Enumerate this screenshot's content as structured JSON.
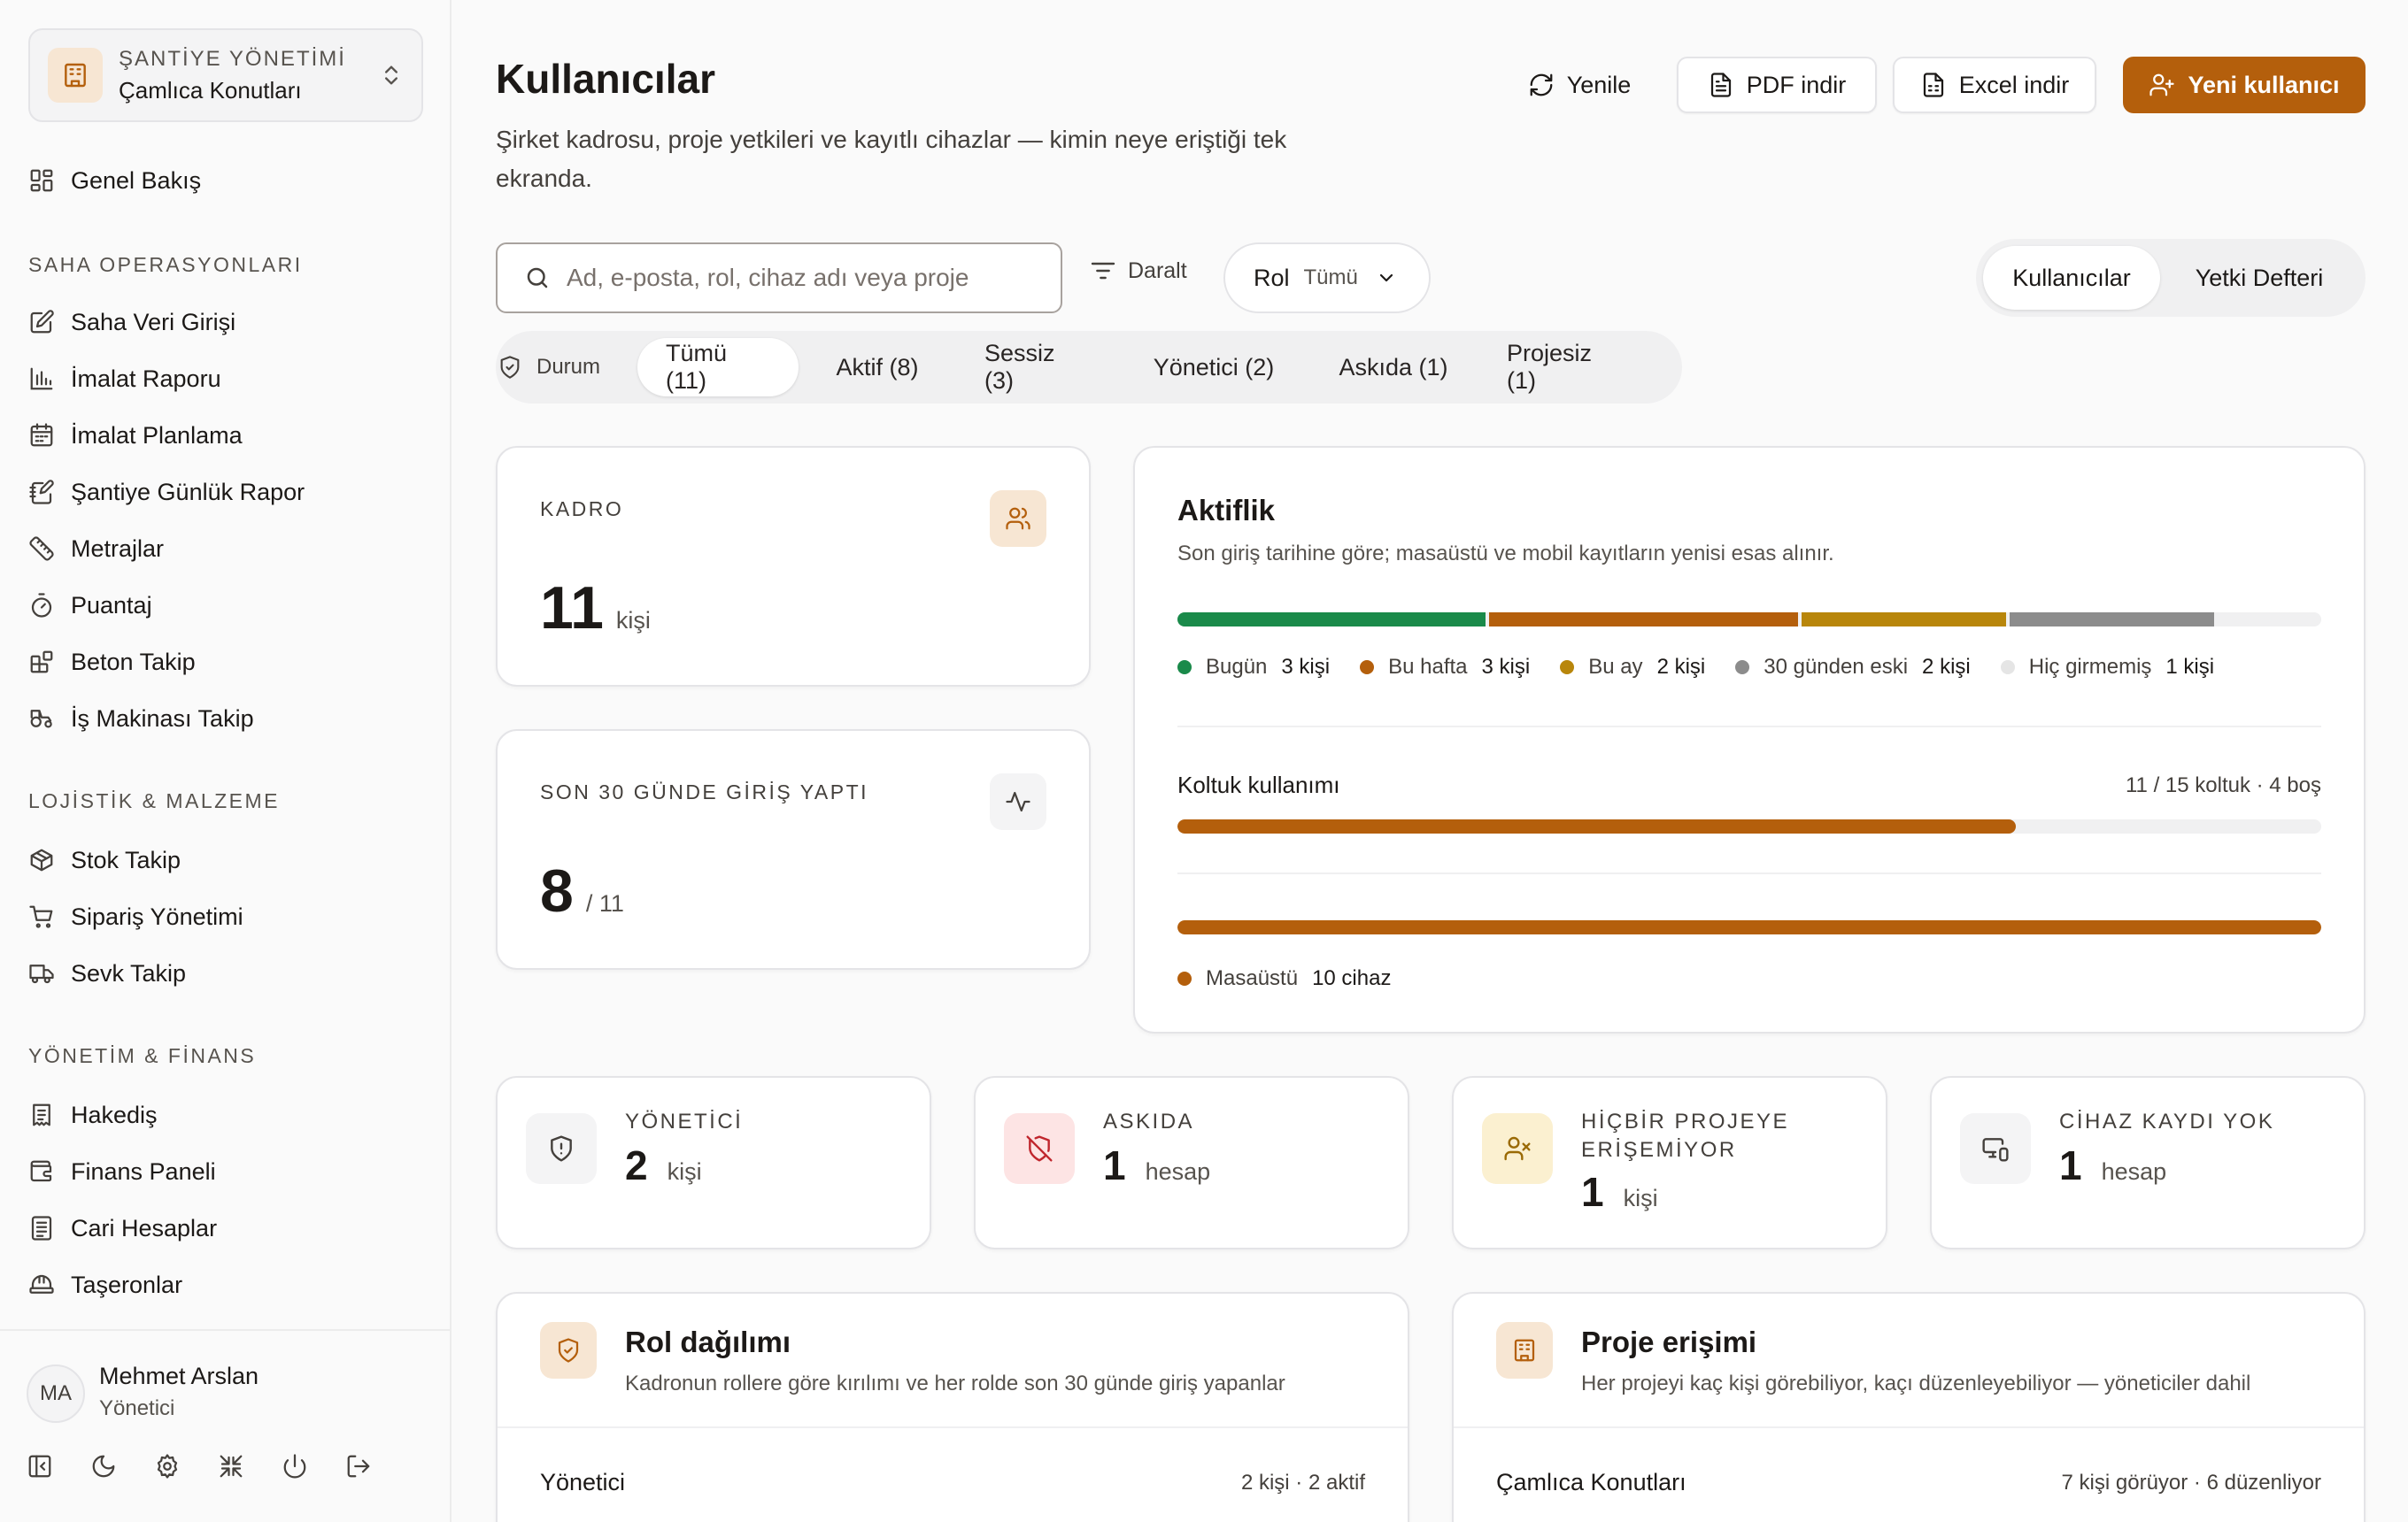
{
  "colors": {
    "accent": "#b45f0c",
    "today": "#1a8a4a",
    "this_week": "#b45f0c",
    "this_month": "#b8860b",
    "older": "#8c8c8c",
    "never": "#e5e5e5"
  },
  "sidebar": {
    "project_switcher": {
      "label": "ŞANTİYE YÖNETİMİ",
      "name": "Çamlıca Konutları",
      "icon": "building-icon"
    },
    "overview": {
      "label": "Genel Bakış",
      "icon": "layout-grid-icon"
    },
    "sections": [
      {
        "title": "SAHA OPERASYONLARI",
        "items": [
          {
            "label": "Saha Veri Girişi",
            "icon": "edit-icon"
          },
          {
            "label": "İmalat Raporu",
            "icon": "bar-chart-icon"
          },
          {
            "label": "İmalat Planlama",
            "icon": "calendar-icon"
          },
          {
            "label": "Şantiye Günlük Rapor",
            "icon": "notebook-pen-icon"
          },
          {
            "label": "Metrajlar",
            "icon": "ruler-icon"
          },
          {
            "label": "Puantaj",
            "icon": "timer-icon"
          },
          {
            "label": "Beton Takip",
            "icon": "blocks-icon"
          },
          {
            "label": "İş Makinası Takip",
            "icon": "tractor-icon"
          }
        ]
      },
      {
        "title": "LOJİSTİK & MALZEME",
        "items": [
          {
            "label": "Stok Takip",
            "icon": "package-icon"
          },
          {
            "label": "Sipariş Yönetimi",
            "icon": "cart-icon"
          },
          {
            "label": "Sevk Takip",
            "icon": "truck-icon"
          }
        ]
      },
      {
        "title": "YÖNETİM & FİNANS",
        "items": [
          {
            "label": "Hakediş",
            "icon": "receipt-icon"
          },
          {
            "label": "Finans Paneli",
            "icon": "wallet-icon"
          },
          {
            "label": "Cari Hesaplar",
            "icon": "ledger-icon"
          },
          {
            "label": "Taşeronlar",
            "icon": "hard-hat-icon"
          }
        ]
      }
    ],
    "user": {
      "initials": "MA",
      "name": "Mehmet Arslan",
      "role": "Yönetici"
    }
  },
  "header": {
    "title": "Kullanıcılar",
    "description": "Şirket kadrosu, proje yetkileri ve kayıtlı cihazlar — kimin neye eriştiği tek ekranda.",
    "refresh_label": "Yenile",
    "pdf_label": "PDF indir",
    "excel_label": "Excel indir",
    "new_user_label": "Yeni kullanıcı"
  },
  "filters": {
    "search_placeholder": "Ad, e-posta, rol, cihaz adı veya proje",
    "narrow_label": "Daralt",
    "role_label": "Rol",
    "role_value": "Tümü",
    "status_label": "Durum",
    "status_chips": [
      "Tümü (11)",
      "Aktif (8)",
      "Sessiz (3)",
      "Yönetici (2)",
      "Askıda (1)",
      "Projesiz (1)"
    ],
    "view_tabs": [
      "Kullanıcılar",
      "Yetki Defteri"
    ]
  },
  "stats": {
    "staff": {
      "label": "KADRO",
      "value": "11",
      "unit": "kişi"
    },
    "logged_in": {
      "label": "SON 30 GÜNDE GİRİŞ YAPTI",
      "value": "8",
      "unit": "/ 11"
    }
  },
  "activity": {
    "title": "Aktiflik",
    "subtitle": "Son giriş tarihine göre; masaüstü ve mobil kayıtların yenisi esas alınır.",
    "segments": [
      {
        "label": "Bugün",
        "count": "3 kişi",
        "value": 3,
        "color": "#1a8a4a"
      },
      {
        "label": "Bu hafta",
        "count": "3 kişi",
        "value": 3,
        "color": "#b45f0c"
      },
      {
        "label": "Bu ay",
        "count": "2 kişi",
        "value": 2,
        "color": "#b8860b"
      },
      {
        "label": "30 günden eski",
        "count": "2 kişi",
        "value": 2,
        "color": "#8c8c8c"
      },
      {
        "label": "Hiç girmemiş",
        "count": "1 kişi",
        "value": 1,
        "color": "#e5e5e5"
      }
    ],
    "seat_label": "Koltuk kullanımı",
    "seat_meta": "11 / 15 koltuk · 4 boş",
    "seat_fraction": 0.7333,
    "device_fraction": 1.0,
    "device_legend": {
      "label": "Masaüstü",
      "count": "10 cihaz"
    }
  },
  "mini_stats": [
    {
      "label": "YÖNETİCİ",
      "value": "2",
      "unit": "kişi",
      "icon": "shield-icon"
    },
    {
      "label": "ASKIDA",
      "value": "1",
      "unit": "hesap",
      "icon": "shield-off-icon"
    },
    {
      "label": "HİÇBİR PROJEYE ERİŞEMİYOR",
      "value": "1",
      "unit": "kişi",
      "icon": "user-x-icon"
    },
    {
      "label": "CİHAZ KAYDI YOK",
      "value": "1",
      "unit": "hesap",
      "icon": "devices-icon"
    }
  ],
  "role_panel": {
    "title": "Rol dağılımı",
    "subtitle": "Kadronun rollere göre kırılımı ve her rolde son 30 günde giriş yapanlar",
    "rows": [
      {
        "label": "Yönetici",
        "meta": "2 kişi · 2 aktif"
      }
    ]
  },
  "project_panel": {
    "title": "Proje erişimi",
    "subtitle": "Her projeyi kaç kişi görebiliyor, kaçı düzenleyebiliyor — yöneticiler dahil",
    "rows": [
      {
        "label": "Çamlıca Konutları",
        "meta": "7 kişi görüyor · 6 düzenliyor"
      }
    ]
  }
}
